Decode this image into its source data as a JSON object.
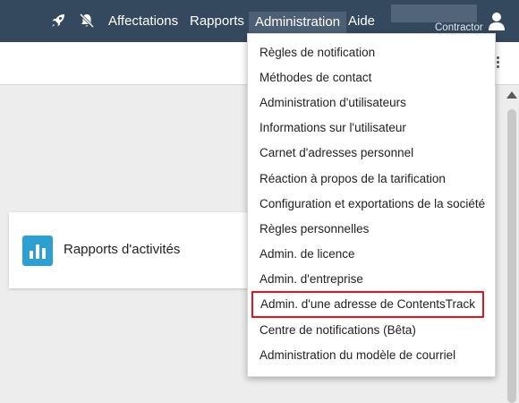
{
  "topbar": {
    "icons": [
      "rocket-icon",
      "bell-slash-icon",
      "user-icon"
    ],
    "nav": [
      {
        "label": "Affectations"
      },
      {
        "label": "Rapports"
      },
      {
        "label": "Administration",
        "active": true
      },
      {
        "label": "Aide"
      }
    ],
    "user_name": "Contractor"
  },
  "card": {
    "icon": "bar-chart-icon",
    "title": "Rapports d'activités"
  },
  "dropdown": {
    "items": [
      {
        "label": "Règles de notification"
      },
      {
        "label": "Méthodes de contact"
      },
      {
        "label": "Administration d'utilisateurs"
      },
      {
        "label": "Informations sur l'utilisateur"
      },
      {
        "label": "Carnet d'adresses personnel"
      },
      {
        "label": "Réaction à propos de la tarification"
      },
      {
        "label": "Configuration et exportations de la société"
      },
      {
        "label": "Règles personnelles"
      },
      {
        "label": "Admin. de licence"
      },
      {
        "label": "Admin. d'entreprise"
      },
      {
        "label": "Admin. d'une adresse de ContentsTrack",
        "highlighted": true
      },
      {
        "label": "Centre de notifications (Bêta)"
      },
      {
        "label": "Administration du modèle de courriel"
      }
    ]
  },
  "colors": {
    "topbar": "#34485e",
    "active_nav": "#4c5f75",
    "card_icon": "#2d9fd1",
    "highlight_border": "#e0141e",
    "page_background": "#ededed"
  }
}
